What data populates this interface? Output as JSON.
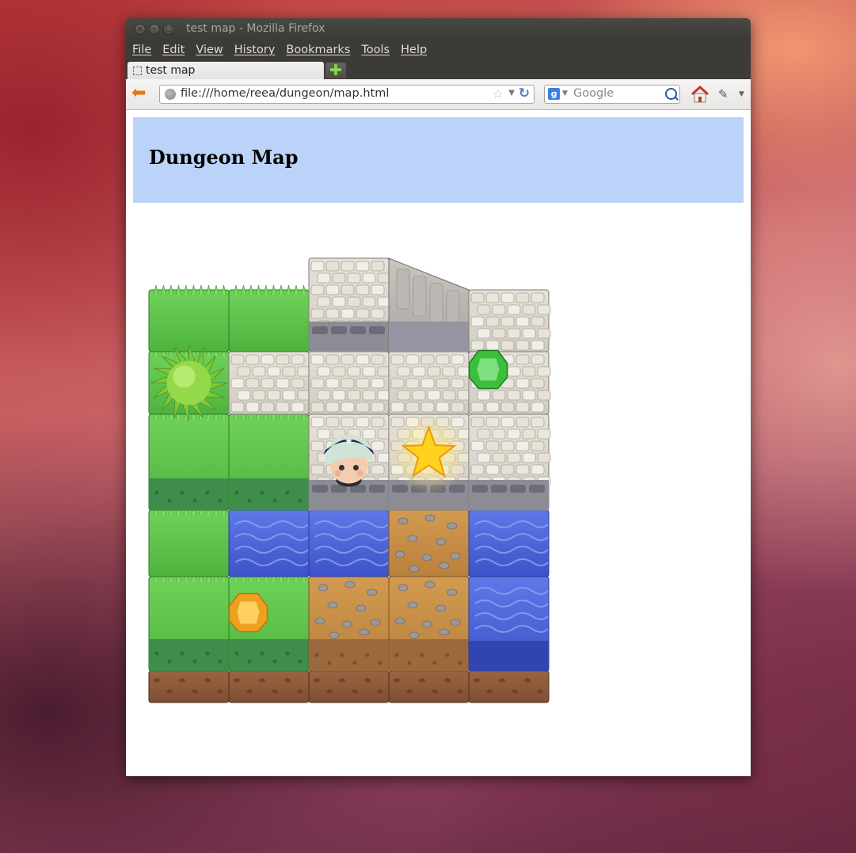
{
  "window": {
    "title": "test map - Mozilla Firefox"
  },
  "menu": [
    "File",
    "Edit",
    "View",
    "History",
    "Bookmarks",
    "Tools",
    "Help"
  ],
  "tab": {
    "label": "test map"
  },
  "nav": {
    "url": "file:///home/reea/dungeon/map.html",
    "search_placeholder": "Google",
    "search_engine_letter": "g"
  },
  "page": {
    "title": "Dungeon Map"
  },
  "map": {
    "columns": 5,
    "rows": [
      [
        "grass",
        "grass",
        "stone",
        "stone-ramp",
        "stone"
      ],
      [
        "grass",
        "stone",
        "stone",
        "stone",
        "stone"
      ],
      [
        "grass",
        "grass",
        "stone",
        "stone",
        "stone"
      ],
      [
        "grass",
        "water",
        "water",
        "dirt",
        "water"
      ],
      [
        "grass",
        "grass",
        "dirt",
        "dirt",
        "water"
      ]
    ],
    "raised": [
      [
        false,
        false,
        true,
        true,
        false
      ],
      [
        false,
        false,
        false,
        false,
        false
      ],
      [
        false,
        false,
        false,
        false,
        false
      ],
      [
        false,
        false,
        false,
        false,
        false
      ],
      [
        false,
        false,
        false,
        false,
        false
      ]
    ],
    "items": [
      {
        "type": "tree",
        "row": 1,
        "col": 0
      },
      {
        "type": "green-gem",
        "row": 1,
        "col": 4
      },
      {
        "type": "character",
        "row": 2,
        "col": 2
      },
      {
        "type": "star",
        "row": 2,
        "col": 3
      },
      {
        "type": "orange-gem",
        "row": 4,
        "col": 1
      }
    ],
    "colors": {
      "grass": "#5cc24a",
      "water": "#4a62d8",
      "dirt": "#c48d46",
      "stone": "#d8d4cc",
      "earth": "#8d5a3a",
      "accent": "#e8761b"
    }
  }
}
